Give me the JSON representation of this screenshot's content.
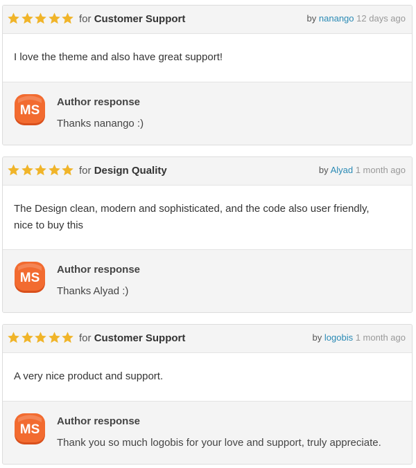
{
  "colors": {
    "star": "#f0b429",
    "link": "#2a8ab5",
    "logo_orange": "#f26b30"
  },
  "icons": {
    "star": "star-icon",
    "logo": "ms-logo"
  },
  "reviews": [
    {
      "rating": 5,
      "for_label": "for",
      "category": "Customer Support",
      "by_label": "by",
      "username": "nanango",
      "time": "12 days ago",
      "body_lines": [
        "I love the theme and also have great support!"
      ],
      "response_title": "Author response",
      "response_text": "Thanks nanango :)",
      "logo_text": "MS"
    },
    {
      "rating": 5,
      "for_label": "for",
      "category": "Design Quality",
      "by_label": "by",
      "username": "Alyad",
      "time": "1 month ago",
      "body_lines": [
        "The Design clean, modern and sophisticated, and the code also user friendly,",
        "nice to buy this"
      ],
      "response_title": "Author response",
      "response_text": "Thanks Alyad :)",
      "logo_text": "MS"
    },
    {
      "rating": 5,
      "for_label": "for",
      "category": "Customer Support",
      "by_label": "by",
      "username": "logobis",
      "time": "1 month ago",
      "body_lines": [
        "A very nice product and support."
      ],
      "response_title": "Author response",
      "response_text": "Thank you so much logobis for your love and support, truly appreciate.",
      "logo_text": "MS"
    }
  ]
}
